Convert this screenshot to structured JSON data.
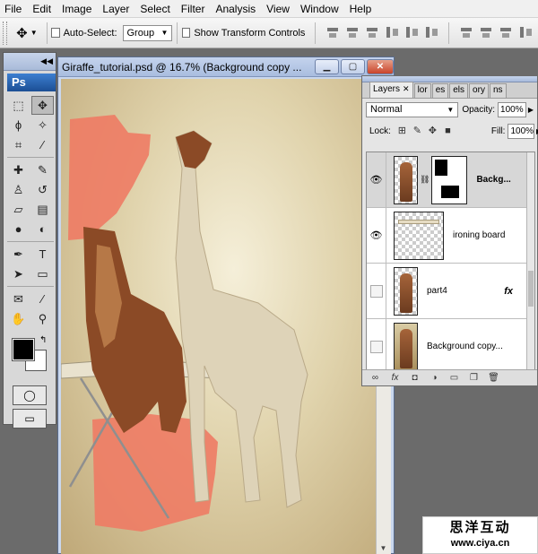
{
  "menubar": {
    "items": [
      "File",
      "Edit",
      "Image",
      "Layer",
      "Select",
      "Filter",
      "Analysis",
      "View",
      "Window",
      "Help"
    ]
  },
  "options": {
    "auto_select_label": "Auto-Select:",
    "auto_select_value": "Group",
    "transform_label": "Show Transform Controls"
  },
  "document": {
    "title": "Giraffe_tutorial.psd @ 16.7% (Background copy ..."
  },
  "tools": {
    "logo": "Ps"
  },
  "layers_panel": {
    "tabs": [
      "Layers",
      "lor",
      "es",
      "els",
      "ory",
      "ns"
    ],
    "blend_mode": "Normal",
    "opacity_label": "Opacity:",
    "opacity_value": "100%",
    "lock_label": "Lock:",
    "fill_label": "Fill:",
    "fill_value": "100%",
    "layers": [
      {
        "name": "Backg...",
        "visible": true,
        "selected": true,
        "has_mask": true
      },
      {
        "name": "ironing board",
        "visible": true,
        "selected": false
      },
      {
        "name": "part4",
        "visible": false,
        "selected": false,
        "fx": "fx"
      },
      {
        "name": "Background copy...",
        "visible": false,
        "selected": false
      }
    ]
  },
  "watermark": {
    "cn": "思洋互动",
    "url": "www.ciya.cn"
  },
  "colors": {
    "paint": "#ee7b64",
    "giraffe_brown": "#8b4a26",
    "giraffe_cream": "#ded3b8"
  }
}
